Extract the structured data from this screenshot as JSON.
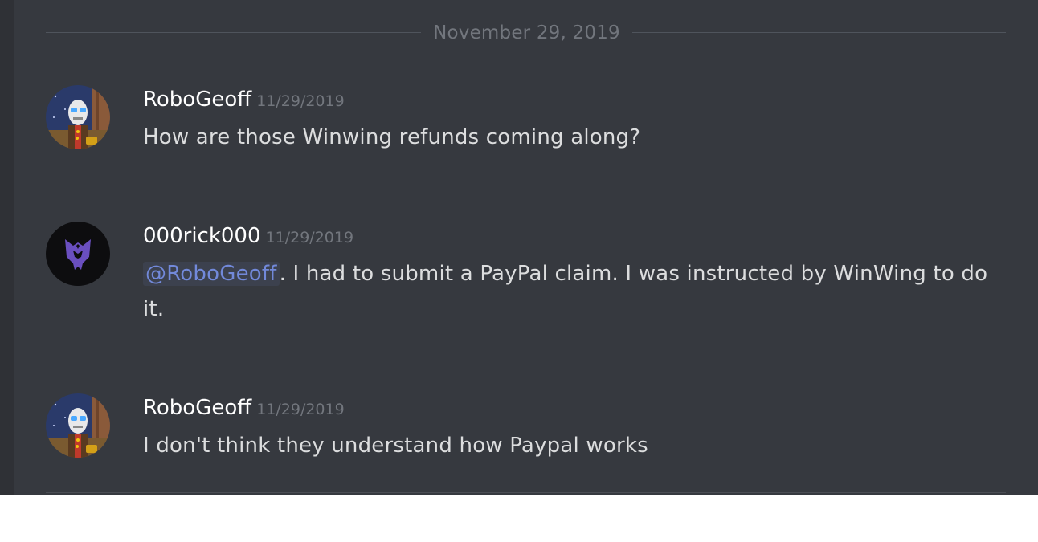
{
  "date_divider": "November 29, 2019",
  "messages": [
    {
      "username": "RoboGeoff",
      "timestamp": "11/29/2019",
      "avatar": "robot-avatar",
      "text": "How are those Winwing refunds coming along?"
    },
    {
      "username": "000rick000",
      "timestamp": "11/29/2019",
      "avatar": "decepticon-avatar",
      "mention": "@RoboGeoff",
      "text": ". I had to submit a PayPal claim.  I was instructed by WinWing to do it."
    },
    {
      "username": "RoboGeoff",
      "timestamp": "11/29/2019",
      "avatar": "robot-avatar",
      "text": "I don't think they understand how Paypal works"
    }
  ],
  "colors": {
    "background": "#36393f",
    "username": "#ffffff",
    "timestamp": "#72767d",
    "message_text": "#dcddde",
    "mention": "#7289da",
    "divider": "#4f545c"
  }
}
